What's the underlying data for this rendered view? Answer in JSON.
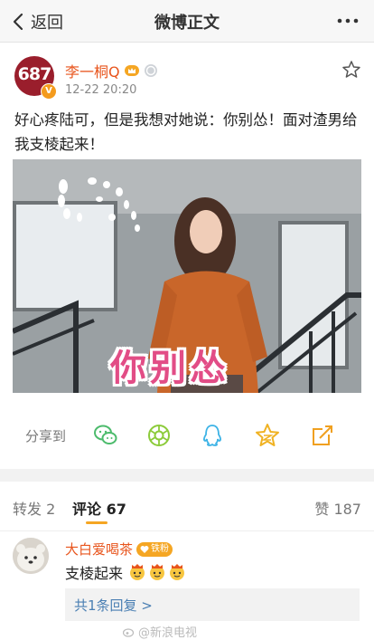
{
  "nav": {
    "back_label": "返回",
    "title": "微博正文"
  },
  "post": {
    "author": "李一桐Q",
    "avatar_text": "687",
    "time": "12-22 20:20",
    "text": "好心疼陆可，但是我想对她说：你别怂！面对渣男给我支棱起来！",
    "media_caption": "你别怂"
  },
  "share": {
    "label": "分享到",
    "targets": [
      "wechat-icon",
      "moments-icon",
      "qq-icon",
      "qzone-icon",
      "edit-share-icon"
    ]
  },
  "tabs": {
    "repost": "转发 2",
    "comments": "评论 67",
    "likes": "赞 187"
  },
  "comment": {
    "author": "大白爱喝茶",
    "badge": "铁粉",
    "text": "支棱起来",
    "reply_link": "共1条回复 >",
    "watermark": "@新浪电视"
  },
  "colors": {
    "username": "#e8551d",
    "tab_underline": "#f5a623",
    "reply_link": "#4a7fb3"
  }
}
